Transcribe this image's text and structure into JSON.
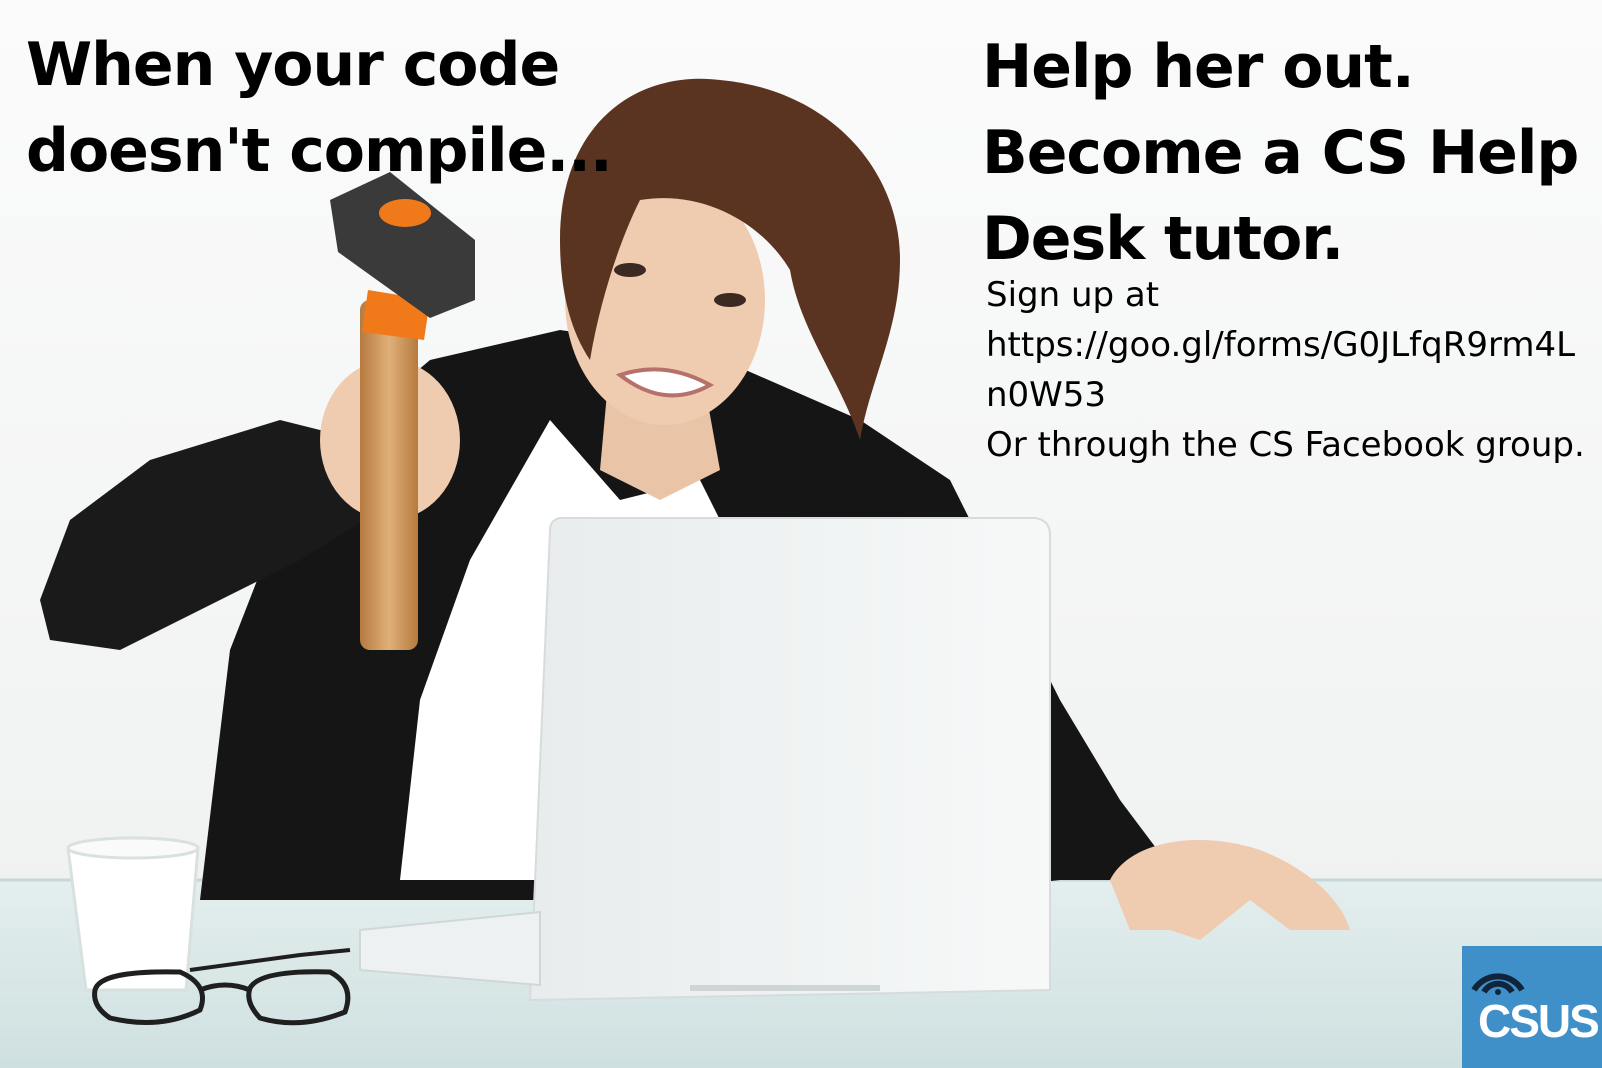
{
  "headline_left": {
    "line1": "When your code",
    "line2": "doesn't compile..."
  },
  "headline_right": {
    "line1": "Help her out.",
    "line2": "Become a CS Help",
    "line3": "Desk tutor."
  },
  "signup": {
    "line1": "Sign up at",
    "line2": "https://goo.gl/forms/G0JLfqR9rm4L",
    "line3": "n0W53",
    "line4": "Or through the CS Facebook group."
  },
  "logo": {
    "text": "CSUS",
    "color": "#3f90c9"
  },
  "colors": {
    "background": "#f7f7f7",
    "hammer_head": "#3a3a3a",
    "hammer_accent": "#f07a1a",
    "hammer_handle": "#d19a5a",
    "jacket": "#141414",
    "laptop": "#f2f4f4"
  }
}
